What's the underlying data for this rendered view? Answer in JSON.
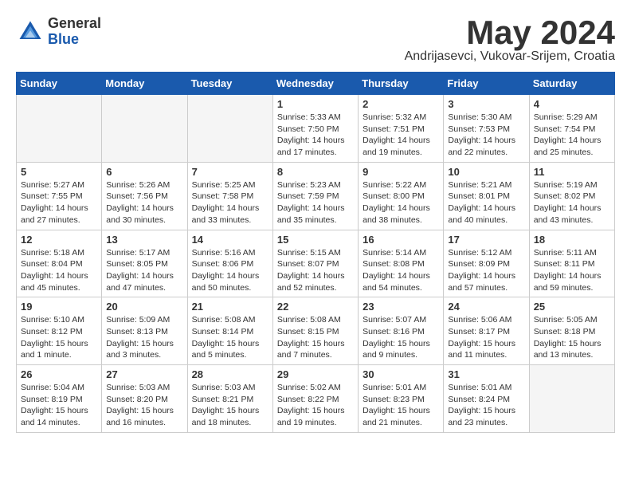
{
  "header": {
    "logo_general": "General",
    "logo_blue": "Blue",
    "month_title": "May 2024",
    "location": "Andrijasevci, Vukovar-Srijem, Croatia"
  },
  "weekdays": [
    "Sunday",
    "Monday",
    "Tuesday",
    "Wednesday",
    "Thursday",
    "Friday",
    "Saturday"
  ],
  "weeks": [
    [
      {
        "day": "",
        "info": ""
      },
      {
        "day": "",
        "info": ""
      },
      {
        "day": "",
        "info": ""
      },
      {
        "day": "1",
        "info": "Sunrise: 5:33 AM\nSunset: 7:50 PM\nDaylight: 14 hours\nand 17 minutes."
      },
      {
        "day": "2",
        "info": "Sunrise: 5:32 AM\nSunset: 7:51 PM\nDaylight: 14 hours\nand 19 minutes."
      },
      {
        "day": "3",
        "info": "Sunrise: 5:30 AM\nSunset: 7:53 PM\nDaylight: 14 hours\nand 22 minutes."
      },
      {
        "day": "4",
        "info": "Sunrise: 5:29 AM\nSunset: 7:54 PM\nDaylight: 14 hours\nand 25 minutes."
      }
    ],
    [
      {
        "day": "5",
        "info": "Sunrise: 5:27 AM\nSunset: 7:55 PM\nDaylight: 14 hours\nand 27 minutes."
      },
      {
        "day": "6",
        "info": "Sunrise: 5:26 AM\nSunset: 7:56 PM\nDaylight: 14 hours\nand 30 minutes."
      },
      {
        "day": "7",
        "info": "Sunrise: 5:25 AM\nSunset: 7:58 PM\nDaylight: 14 hours\nand 33 minutes."
      },
      {
        "day": "8",
        "info": "Sunrise: 5:23 AM\nSunset: 7:59 PM\nDaylight: 14 hours\nand 35 minutes."
      },
      {
        "day": "9",
        "info": "Sunrise: 5:22 AM\nSunset: 8:00 PM\nDaylight: 14 hours\nand 38 minutes."
      },
      {
        "day": "10",
        "info": "Sunrise: 5:21 AM\nSunset: 8:01 PM\nDaylight: 14 hours\nand 40 minutes."
      },
      {
        "day": "11",
        "info": "Sunrise: 5:19 AM\nSunset: 8:02 PM\nDaylight: 14 hours\nand 43 minutes."
      }
    ],
    [
      {
        "day": "12",
        "info": "Sunrise: 5:18 AM\nSunset: 8:04 PM\nDaylight: 14 hours\nand 45 minutes."
      },
      {
        "day": "13",
        "info": "Sunrise: 5:17 AM\nSunset: 8:05 PM\nDaylight: 14 hours\nand 47 minutes."
      },
      {
        "day": "14",
        "info": "Sunrise: 5:16 AM\nSunset: 8:06 PM\nDaylight: 14 hours\nand 50 minutes."
      },
      {
        "day": "15",
        "info": "Sunrise: 5:15 AM\nSunset: 8:07 PM\nDaylight: 14 hours\nand 52 minutes."
      },
      {
        "day": "16",
        "info": "Sunrise: 5:14 AM\nSunset: 8:08 PM\nDaylight: 14 hours\nand 54 minutes."
      },
      {
        "day": "17",
        "info": "Sunrise: 5:12 AM\nSunset: 8:09 PM\nDaylight: 14 hours\nand 57 minutes."
      },
      {
        "day": "18",
        "info": "Sunrise: 5:11 AM\nSunset: 8:11 PM\nDaylight: 14 hours\nand 59 minutes."
      }
    ],
    [
      {
        "day": "19",
        "info": "Sunrise: 5:10 AM\nSunset: 8:12 PM\nDaylight: 15 hours\nand 1 minute."
      },
      {
        "day": "20",
        "info": "Sunrise: 5:09 AM\nSunset: 8:13 PM\nDaylight: 15 hours\nand 3 minutes."
      },
      {
        "day": "21",
        "info": "Sunrise: 5:08 AM\nSunset: 8:14 PM\nDaylight: 15 hours\nand 5 minutes."
      },
      {
        "day": "22",
        "info": "Sunrise: 5:08 AM\nSunset: 8:15 PM\nDaylight: 15 hours\nand 7 minutes."
      },
      {
        "day": "23",
        "info": "Sunrise: 5:07 AM\nSunset: 8:16 PM\nDaylight: 15 hours\nand 9 minutes."
      },
      {
        "day": "24",
        "info": "Sunrise: 5:06 AM\nSunset: 8:17 PM\nDaylight: 15 hours\nand 11 minutes."
      },
      {
        "day": "25",
        "info": "Sunrise: 5:05 AM\nSunset: 8:18 PM\nDaylight: 15 hours\nand 13 minutes."
      }
    ],
    [
      {
        "day": "26",
        "info": "Sunrise: 5:04 AM\nSunset: 8:19 PM\nDaylight: 15 hours\nand 14 minutes."
      },
      {
        "day": "27",
        "info": "Sunrise: 5:03 AM\nSunset: 8:20 PM\nDaylight: 15 hours\nand 16 minutes."
      },
      {
        "day": "28",
        "info": "Sunrise: 5:03 AM\nSunset: 8:21 PM\nDaylight: 15 hours\nand 18 minutes."
      },
      {
        "day": "29",
        "info": "Sunrise: 5:02 AM\nSunset: 8:22 PM\nDaylight: 15 hours\nand 19 minutes."
      },
      {
        "day": "30",
        "info": "Sunrise: 5:01 AM\nSunset: 8:23 PM\nDaylight: 15 hours\nand 21 minutes."
      },
      {
        "day": "31",
        "info": "Sunrise: 5:01 AM\nSunset: 8:24 PM\nDaylight: 15 hours\nand 23 minutes."
      },
      {
        "day": "",
        "info": ""
      }
    ]
  ]
}
